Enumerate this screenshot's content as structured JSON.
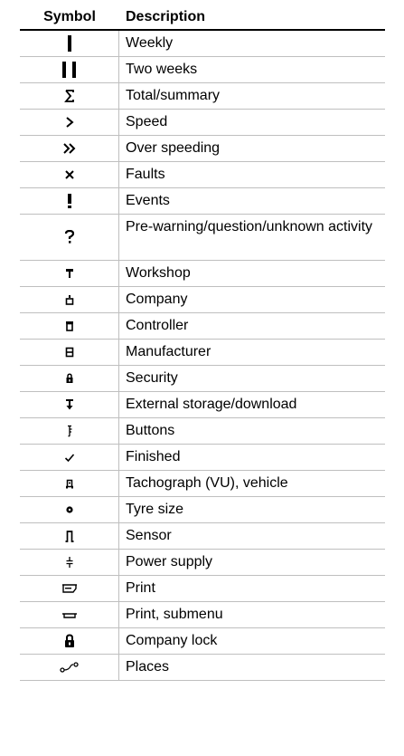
{
  "header": {
    "symbol": "Symbol",
    "description": "Description"
  },
  "rows": [
    {
      "icon": "weekly-icon",
      "description": "Weekly"
    },
    {
      "icon": "two-weeks-icon",
      "description": "Two weeks"
    },
    {
      "icon": "sigma-icon",
      "description": "Total/summary"
    },
    {
      "icon": "speed-icon",
      "description": "Speed"
    },
    {
      "icon": "over-speeding-icon",
      "description": "Over speeding"
    },
    {
      "icon": "faults-icon",
      "description": "Faults"
    },
    {
      "icon": "events-icon",
      "description": "Events"
    },
    {
      "icon": "question-icon",
      "description": "Pre-warning/question/unknown activity"
    },
    {
      "icon": "workshop-icon",
      "description": "Workshop"
    },
    {
      "icon": "company-icon",
      "description": "Company"
    },
    {
      "icon": "controller-icon",
      "description": "Controller"
    },
    {
      "icon": "manufacturer-icon",
      "description": "Manufacturer"
    },
    {
      "icon": "security-icon",
      "description": "Security"
    },
    {
      "icon": "download-icon",
      "description": "External storage/download"
    },
    {
      "icon": "buttons-icon",
      "description": "Buttons"
    },
    {
      "icon": "finished-icon",
      "description": "Finished"
    },
    {
      "icon": "tachograph-icon",
      "description": "Tachograph (VU), vehicle"
    },
    {
      "icon": "tyre-size-icon",
      "description": "Tyre size"
    },
    {
      "icon": "sensor-icon",
      "description": "Sensor"
    },
    {
      "icon": "power-supply-icon",
      "description": "Power supply"
    },
    {
      "icon": "print-icon",
      "description": "Print"
    },
    {
      "icon": "print-submenu-icon",
      "description": "Print, submenu"
    },
    {
      "icon": "company-lock-icon",
      "description": "Company lock"
    },
    {
      "icon": "places-icon",
      "description": "Places"
    }
  ]
}
